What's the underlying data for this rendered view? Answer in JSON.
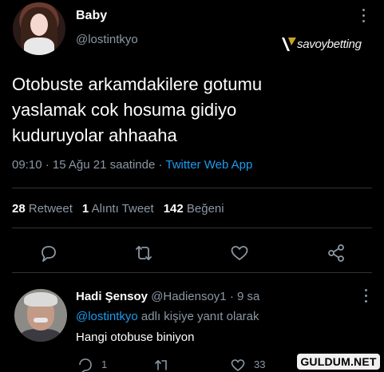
{
  "tweet": {
    "author_name": "Baby",
    "author_handle": "@lostintkyo",
    "text": "Otobuste arkamdakilere gotumu\nyaslamak cok hosuma gidiyo\nkuduruyolar ahhaaha",
    "time": "09:10 · 15 Ağu 21 saatinde · ",
    "source": "Twitter Web App",
    "retweet_count": "28",
    "retweet_label": "Retweet",
    "quote_count": "1",
    "quote_label": "Alıntı Tweet",
    "like_count": "142",
    "like_label": "Beğeni"
  },
  "actions": {
    "icons": [
      "reply-icon",
      "retweet-icon",
      "like-icon",
      "share-icon"
    ]
  },
  "reply": {
    "author_name": "Hadi Şensoy",
    "author_handle": "@Hadiensoy1",
    "time": " · 9 sa",
    "mention": "@lostintkyo",
    "reply_to_suffix": " adlı kişiye yanıt olarak",
    "text": "Hangi otobuse biniyon",
    "reply_count": "1",
    "like_count": "33"
  },
  "watermarks": {
    "savoy": "savoybetting",
    "guldum": "GULDUM.NET"
  },
  "colors": {
    "background": "#000000",
    "accent": "#1d9bf0",
    "muted": "#8b98a5",
    "divider": "#2f3336"
  }
}
